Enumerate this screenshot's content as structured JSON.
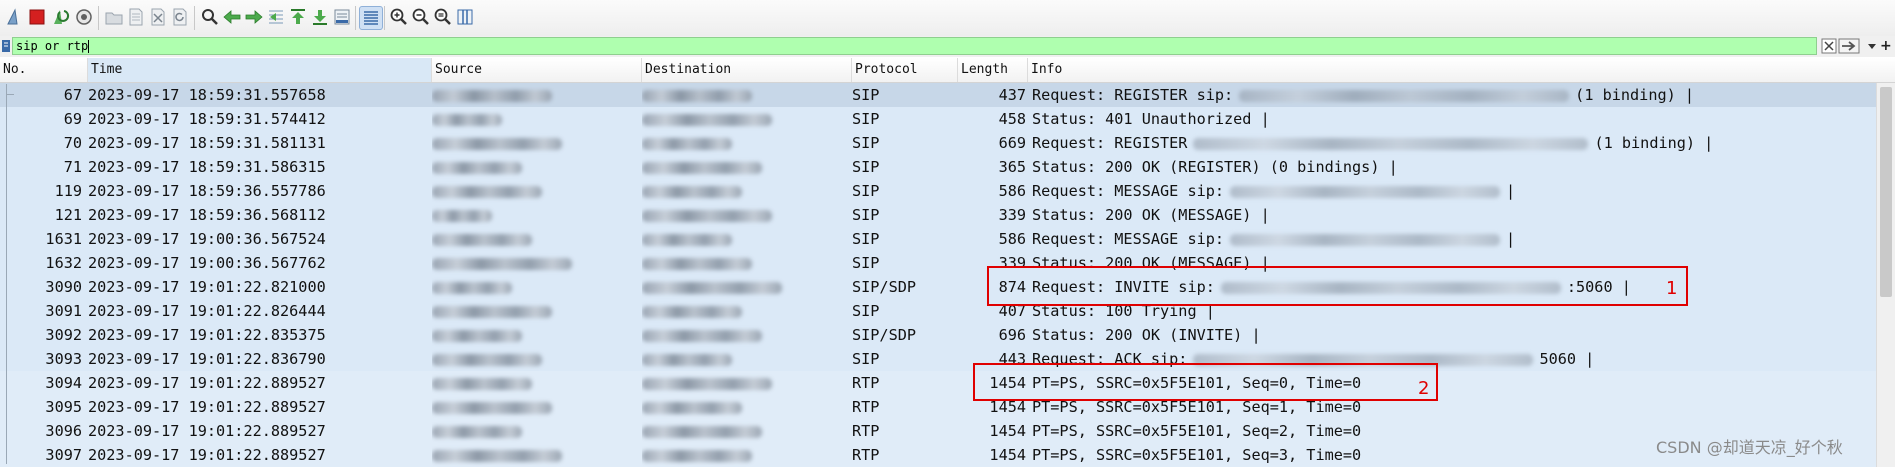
{
  "toolbar": {
    "buttons": [
      {
        "name": "shark-fin-start-icon",
        "color": "#7aa0c8"
      },
      {
        "name": "stop-capture-icon",
        "color": "#d42020"
      },
      {
        "name": "restart-capture-icon",
        "color": "#3aa040"
      },
      {
        "name": "capture-options-icon",
        "color": "#606060"
      },
      {
        "name": "open-file-icon",
        "color": "#9aa4ae"
      },
      {
        "name": "save-file-icon",
        "color": "#9aa4ae"
      },
      {
        "name": "close-file-icon",
        "color": "#9aa4ae"
      },
      {
        "name": "reload-file-icon",
        "color": "#9aa4ae"
      },
      {
        "name": "find-packet-icon",
        "color": "#333333"
      },
      {
        "name": "go-back-icon",
        "color": "#3a9a3a"
      },
      {
        "name": "go-forward-icon",
        "color": "#3a9a3a"
      },
      {
        "name": "go-to-packet-icon",
        "color": "#3a9a3a"
      },
      {
        "name": "go-first-icon",
        "color": "#3a9a3a"
      },
      {
        "name": "go-last-icon",
        "color": "#3a9a3a"
      },
      {
        "name": "auto-scroll-icon",
        "color": "#3a6aa8"
      },
      {
        "name": "colorize-icon",
        "color": "#3a6aa8"
      },
      {
        "name": "zoom-in-icon",
        "color": "#333333"
      },
      {
        "name": "zoom-out-icon",
        "color": "#333333"
      },
      {
        "name": "zoom-normal-icon",
        "color": "#333333"
      },
      {
        "name": "resize-columns-icon",
        "color": "#3a6aa8"
      }
    ]
  },
  "filter": {
    "value": "sip or rtp",
    "background": "#afffaf"
  },
  "columns": [
    {
      "key": "no",
      "label": "No."
    },
    {
      "key": "time",
      "label": "Time"
    },
    {
      "key": "source",
      "label": "Source"
    },
    {
      "key": "destination",
      "label": "Destination"
    },
    {
      "key": "protocol",
      "label": "Protocol"
    },
    {
      "key": "length",
      "label": "Length"
    },
    {
      "key": "info",
      "label": "Info"
    }
  ],
  "packets": [
    {
      "no": "67",
      "time": "2023-09-17 18:59:31.557658",
      "protocol": "SIP",
      "length": "437",
      "info": "Request: REGISTER sip:",
      "info_tail": "(1 binding) |",
      "redacted": true,
      "selected": true
    },
    {
      "no": "69",
      "time": "2023-09-17 18:59:31.574412",
      "protocol": "SIP",
      "length": "458",
      "info": "Status: 401 Unauthorized |",
      "info_tail": "",
      "redacted": false
    },
    {
      "no": "70",
      "time": "2023-09-17 18:59:31.581131",
      "protocol": "SIP",
      "length": "669",
      "info": "Request: REGISTER",
      "info_tail": "(1 binding) |",
      "redacted": true
    },
    {
      "no": "71",
      "time": "2023-09-17 18:59:31.586315",
      "protocol": "SIP",
      "length": "365",
      "info": "Status: 200 OK (REGISTER)  (0 bindings) |",
      "info_tail": "",
      "redacted": false
    },
    {
      "no": "119",
      "time": "2023-09-17 18:59:36.557786",
      "protocol": "SIP",
      "length": "586",
      "info": "Request: MESSAGE sip:",
      "info_tail": "|",
      "redacted": true
    },
    {
      "no": "121",
      "time": "2023-09-17 18:59:36.568112",
      "protocol": "SIP",
      "length": "339",
      "info": "Status: 200 OK (MESSAGE) |",
      "info_tail": "",
      "redacted": false
    },
    {
      "no": "1631",
      "time": "2023-09-17 19:00:36.567524",
      "protocol": "SIP",
      "length": "586",
      "info": "Request: MESSAGE sip:",
      "info_tail": "|",
      "redacted": true
    },
    {
      "no": "1632",
      "time": "2023-09-17 19:00:36.567762",
      "protocol": "SIP",
      "length": "339",
      "info": "Status: 200 OK (MESSAGE) |",
      "info_tail": "",
      "redacted": false
    },
    {
      "no": "3090",
      "time": "2023-09-17 19:01:22.821000",
      "protocol": "SIP/SDP",
      "length": "874",
      "info": "Request: INVITE sip:",
      "info_tail": ":5060 |",
      "redacted": true
    },
    {
      "no": "3091",
      "time": "2023-09-17 19:01:22.826444",
      "protocol": "SIP",
      "length": "407",
      "info": "Status: 100 Trying |",
      "info_tail": "",
      "redacted": false
    },
    {
      "no": "3092",
      "time": "2023-09-17 19:01:22.835375",
      "protocol": "SIP/SDP",
      "length": "696",
      "info": "Status: 200 OK (INVITE) |",
      "info_tail": "",
      "redacted": false
    },
    {
      "no": "3093",
      "time": "2023-09-17 19:01:22.836790",
      "protocol": "SIP",
      "length": "443",
      "info": "Request: ACK sip:",
      "info_tail": "5060 |",
      "redacted": true
    },
    {
      "no": "3094",
      "time": "2023-09-17 19:01:22.889527",
      "protocol": "RTP",
      "length": "1454",
      "info": "PT=PS, SSRC=0x5F5E101, Seq=0, Time=0",
      "info_tail": "",
      "redacted": false
    },
    {
      "no": "3095",
      "time": "2023-09-17 19:01:22.889527",
      "protocol": "RTP",
      "length": "1454",
      "info": "PT=PS, SSRC=0x5F5E101, Seq=1, Time=0",
      "info_tail": "",
      "redacted": false
    },
    {
      "no": "3096",
      "time": "2023-09-17 19:01:22.889527",
      "protocol": "RTP",
      "length": "1454",
      "info": "PT=PS, SSRC=0x5F5E101, Seq=2, Time=0",
      "info_tail": "",
      "redacted": false
    },
    {
      "no": "3097",
      "time": "2023-09-17 19:01:22.889527",
      "protocol": "RTP",
      "length": "1454",
      "info": "PT=PS, SSRC=0x5F5E101, Seq=3, Time=0",
      "info_tail": "",
      "redacted": false
    }
  ],
  "annotations": [
    {
      "label": "1",
      "color": "#e00000"
    },
    {
      "label": "2",
      "color": "#e00000"
    }
  ],
  "watermark": "CSDN @却道天凉_好个秋"
}
